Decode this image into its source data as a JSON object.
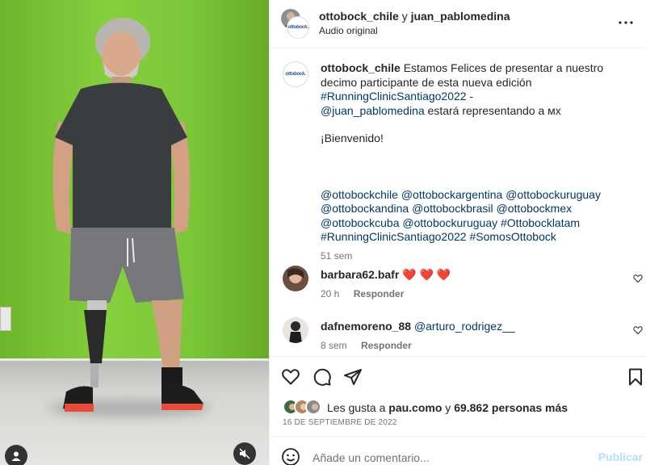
{
  "header": {
    "user1": "ottobock_chile",
    "connector": "y",
    "user2": "juan_pablomedina",
    "audio": "Audio original",
    "logo_text": "ottobock."
  },
  "caption": {
    "username": "ottobock_chile",
    "text1": "Estamos Felices de presentar a nuestro decimo participante de esta nueva edición",
    "hashtag_main": "#RunningClinicSantiago2022",
    "dash": " -",
    "mention": "@juan_pablomedina",
    "text2": " estará representando a ᴍx",
    "welcome": "¡Bienvenido!",
    "tags_line1": "@ottobockchile @ottobockargentina @ottobockuruguay",
    "tags_line2": "@ottobockandina @ottobockbrasil @ottobockmex",
    "tags_line3": "@ottobockcuba @ottobockuruguay #Ottobocklatam",
    "tags_line4": "#RunningClinicSantiago2022 #SomosOttobock",
    "time": "51 sem"
  },
  "comments": [
    {
      "username": "barbara62.bafr",
      "text": "❤️ ❤️ ❤️",
      "time": "20 h",
      "reply": "Responder"
    },
    {
      "username": "dafnemoreno_88",
      "text": "@arturo_rodrigez__",
      "time": "8 sem",
      "reply": "Responder"
    }
  ],
  "likes": {
    "prefix": "Les gusta a",
    "user": "pau.como",
    "connector": "y",
    "count": "69.862 personas más"
  },
  "date": "16 DE SEPTIEMBRE DE 2022",
  "add_comment": {
    "placeholder": "Añade un comentario...",
    "publish": "Publicar"
  },
  "colors": {
    "wall_green": "#7cc43a",
    "link": "#00376b",
    "publish_disabled": "#b2dffc",
    "heart": "#ed1c24"
  }
}
